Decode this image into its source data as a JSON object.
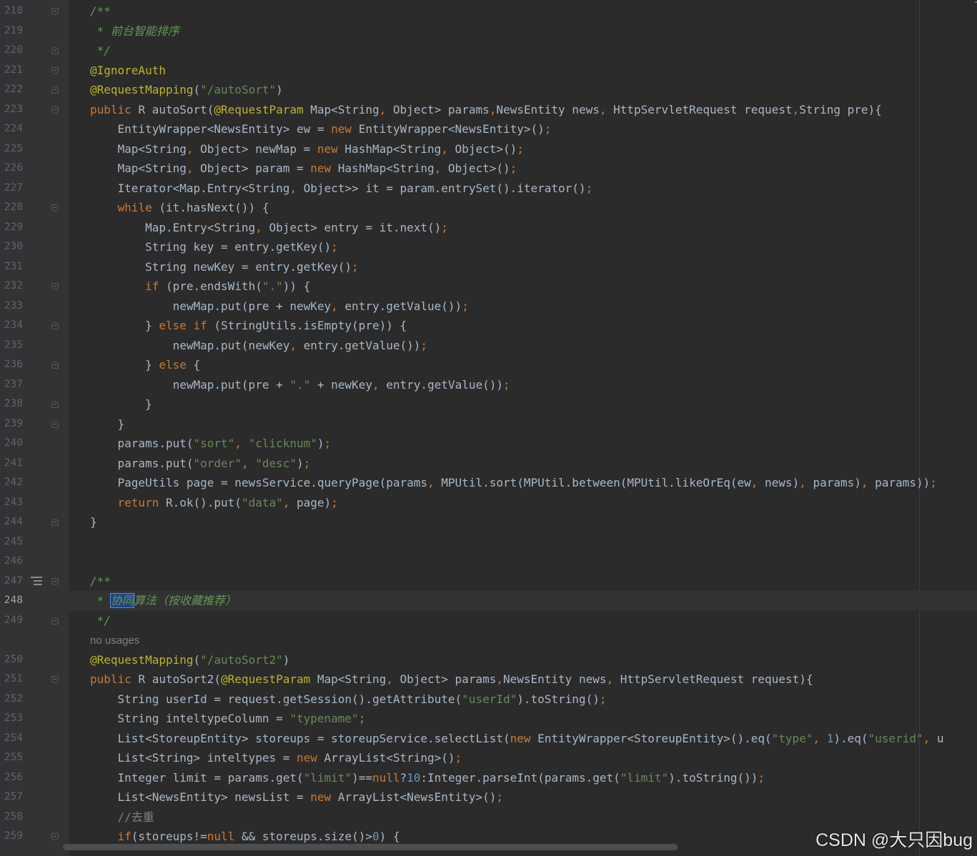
{
  "editor": {
    "lines": [
      {
        "n": "218",
        "fold": "start",
        "segs": [
          [
            "cmt",
            "/**"
          ]
        ]
      },
      {
        "n": "219",
        "segs": [
          [
            "cmt",
            " * 前台智能排序"
          ]
        ]
      },
      {
        "n": "220",
        "fold": "end",
        "segs": [
          [
            "cmt",
            " */"
          ]
        ]
      },
      {
        "n": "221",
        "fold": "start",
        "segs": [
          [
            "ann",
            "@IgnoreAuth"
          ]
        ]
      },
      {
        "n": "222",
        "fold": "end",
        "segs": [
          [
            "ann",
            "@RequestMapping"
          ],
          [
            "",
            "("
          ],
          [
            "str",
            "\"/autoSort\""
          ],
          [
            "",
            ")"
          ]
        ]
      },
      {
        "n": "223",
        "fold": "start",
        "segs": [
          [
            "kw",
            "public "
          ],
          [
            "",
            "R autoSort("
          ],
          [
            "ann",
            "@RequestParam "
          ],
          [
            "",
            "Map<String"
          ],
          [
            "kw",
            ", "
          ],
          [
            "",
            "Object> params"
          ],
          [
            "kw",
            ","
          ],
          [
            "",
            "NewsEntity news"
          ],
          [
            "kw",
            ", "
          ],
          [
            "",
            "HttpServletRequest request"
          ],
          [
            "kw",
            ","
          ],
          [
            "",
            "String pre){"
          ]
        ]
      },
      {
        "n": "224",
        "segs": [
          [
            "",
            "    EntityWrapper<NewsEntity> ew = "
          ],
          [
            "kw",
            "new "
          ],
          [
            "",
            "EntityWrapper<NewsEntity>()"
          ],
          [
            "kw",
            ";"
          ]
        ]
      },
      {
        "n": "225",
        "segs": [
          [
            "",
            "    Map<String"
          ],
          [
            "kw",
            ", "
          ],
          [
            "",
            "Object> newMap = "
          ],
          [
            "kw",
            "new "
          ],
          [
            "",
            "HashMap<String"
          ],
          [
            "kw",
            ", "
          ],
          [
            "",
            "Object>()"
          ],
          [
            "kw",
            ";"
          ]
        ]
      },
      {
        "n": "226",
        "segs": [
          [
            "",
            "    Map<String"
          ],
          [
            "kw",
            ", "
          ],
          [
            "",
            "Object> param = "
          ],
          [
            "kw",
            "new "
          ],
          [
            "",
            "HashMap<String"
          ],
          [
            "kw",
            ", "
          ],
          [
            "",
            "Object>()"
          ],
          [
            "kw",
            ";"
          ]
        ]
      },
      {
        "n": "227",
        "segs": [
          [
            "",
            "    Iterator<Map.Entry<String"
          ],
          [
            "kw",
            ", "
          ],
          [
            "",
            "Object>> it = param.entrySet().iterator()"
          ],
          [
            "kw",
            ";"
          ]
        ]
      },
      {
        "n": "228",
        "fold": "start",
        "segs": [
          [
            "",
            "    "
          ],
          [
            "kw",
            "while "
          ],
          [
            "",
            "(it.hasNext()) {"
          ]
        ]
      },
      {
        "n": "229",
        "segs": [
          [
            "",
            "        Map.Entry<String"
          ],
          [
            "kw",
            ", "
          ],
          [
            "",
            "Object> entry = it.next()"
          ],
          [
            "kw",
            ";"
          ]
        ]
      },
      {
        "n": "230",
        "segs": [
          [
            "",
            "        String key = entry.getKey()"
          ],
          [
            "kw",
            ";"
          ]
        ]
      },
      {
        "n": "231",
        "segs": [
          [
            "",
            "        String newKey = entry.getKey()"
          ],
          [
            "kw",
            ";"
          ]
        ]
      },
      {
        "n": "232",
        "fold": "start",
        "segs": [
          [
            "",
            "        "
          ],
          [
            "kw",
            "if "
          ],
          [
            "",
            "(pre.endsWith("
          ],
          [
            "str",
            "\".\""
          ],
          [
            "",
            ")) {"
          ]
        ]
      },
      {
        "n": "233",
        "segs": [
          [
            "",
            "            newMap.put(pre + newKey"
          ],
          [
            "kw",
            ", "
          ],
          [
            "",
            "entry.getValue())"
          ],
          [
            "kw",
            ";"
          ]
        ]
      },
      {
        "n": "234",
        "fold": "end",
        "segs": [
          [
            "",
            "        } "
          ],
          [
            "kw",
            "else if "
          ],
          [
            "",
            "(StringUtils.isEmpty(pre)) {"
          ]
        ]
      },
      {
        "n": "235",
        "segs": [
          [
            "",
            "            newMap.put(newKey"
          ],
          [
            "kw",
            ", "
          ],
          [
            "",
            "entry.getValue())"
          ],
          [
            "kw",
            ";"
          ]
        ]
      },
      {
        "n": "236",
        "fold": "end",
        "segs": [
          [
            "",
            "        } "
          ],
          [
            "kw",
            "else "
          ],
          [
            "",
            "{"
          ]
        ]
      },
      {
        "n": "237",
        "segs": [
          [
            "",
            "            newMap.put(pre + "
          ],
          [
            "str",
            "\".\""
          ],
          [
            "",
            " + newKey"
          ],
          [
            "kw",
            ", "
          ],
          [
            "",
            "entry.getValue())"
          ],
          [
            "kw",
            ";"
          ]
        ]
      },
      {
        "n": "238",
        "fold": "end",
        "segs": [
          [
            "",
            "        }"
          ]
        ]
      },
      {
        "n": "239",
        "fold": "end",
        "segs": [
          [
            "",
            "    }"
          ]
        ]
      },
      {
        "n": "240",
        "segs": [
          [
            "",
            "    params.put("
          ],
          [
            "str",
            "\"sort\""
          ],
          [
            "kw",
            ", "
          ],
          [
            "str",
            "\"clicknum\""
          ],
          [
            "",
            ")"
          ],
          [
            "kw",
            ";"
          ]
        ]
      },
      {
        "n": "241",
        "segs": [
          [
            "",
            "    params.put("
          ],
          [
            "str",
            "\"order\""
          ],
          [
            "kw",
            ", "
          ],
          [
            "str",
            "\"desc\""
          ],
          [
            "",
            ")"
          ],
          [
            "kw",
            ";"
          ]
        ]
      },
      {
        "n": "242",
        "segs": [
          [
            "",
            "    PageUtils page = newsService.queryPage(params"
          ],
          [
            "kw",
            ", "
          ],
          [
            "",
            "MPUtil.sort(MPUtil.between(MPUtil.likeOrEq(ew"
          ],
          [
            "kw",
            ", "
          ],
          [
            "",
            "news)"
          ],
          [
            "kw",
            ", "
          ],
          [
            "",
            "params)"
          ],
          [
            "kw",
            ", "
          ],
          [
            "",
            "params))"
          ],
          [
            "kw",
            ";"
          ]
        ]
      },
      {
        "n": "243",
        "segs": [
          [
            "",
            "    "
          ],
          [
            "kw",
            "return "
          ],
          [
            "",
            "R.ok().put("
          ],
          [
            "str",
            "\"data\""
          ],
          [
            "kw",
            ", "
          ],
          [
            "",
            "page)"
          ],
          [
            "kw",
            ";"
          ]
        ]
      },
      {
        "n": "244",
        "fold": "end",
        "segs": [
          [
            "",
            "}"
          ]
        ]
      },
      {
        "n": "245",
        "segs": []
      },
      {
        "n": "246",
        "segs": []
      },
      {
        "n": "247",
        "fold": "start",
        "docicon": true,
        "segs": [
          [
            "cmt",
            "/**"
          ]
        ]
      },
      {
        "n": "248",
        "current": true,
        "segs": [
          [
            "cmt",
            " * "
          ],
          [
            "cmt sel",
            "协同"
          ],
          [
            "cmt",
            "算法（按收藏推荐）"
          ]
        ]
      },
      {
        "n": "249",
        "fold": "end",
        "segs": [
          [
            "cmt",
            " */"
          ]
        ]
      },
      {
        "n": "",
        "hint": true,
        "segs": [
          [
            "hint",
            "no usages"
          ]
        ]
      },
      {
        "n": "250",
        "segs": [
          [
            "ann",
            "@RequestMapping"
          ],
          [
            "",
            "("
          ],
          [
            "str",
            "\"/autoSort2\""
          ],
          [
            "",
            ")"
          ]
        ]
      },
      {
        "n": "251",
        "fold": "start",
        "segs": [
          [
            "kw",
            "public "
          ],
          [
            "",
            "R autoSort2("
          ],
          [
            "ann",
            "@RequestParam "
          ],
          [
            "",
            "Map<String"
          ],
          [
            "kw",
            ", "
          ],
          [
            "",
            "Object> params"
          ],
          [
            "kw",
            ","
          ],
          [
            "",
            "NewsEntity news"
          ],
          [
            "kw",
            ", "
          ],
          [
            "",
            "HttpServletRequest request){"
          ]
        ]
      },
      {
        "n": "252",
        "segs": [
          [
            "",
            "    String userId = request.getSession().getAttribute("
          ],
          [
            "str",
            "\"userId\""
          ],
          [
            "",
            ").toString()"
          ],
          [
            "kw",
            ";"
          ]
        ]
      },
      {
        "n": "253",
        "segs": [
          [
            "",
            "    String inteltypeColumn = "
          ],
          [
            "str",
            "\"typename\""
          ],
          [
            "kw",
            ";"
          ]
        ]
      },
      {
        "n": "254",
        "segs": [
          [
            "",
            "    List<StoreupEntity> storeups = storeupService.selectList("
          ],
          [
            "kw",
            "new "
          ],
          [
            "",
            "EntityWrapper<StoreupEntity>().eq("
          ],
          [
            "str",
            "\"type\""
          ],
          [
            "kw",
            ", "
          ],
          [
            "num",
            "1"
          ],
          [
            "",
            ").eq("
          ],
          [
            "str",
            "\"userid\""
          ],
          [
            "kw",
            ", "
          ],
          [
            "",
            "u"
          ]
        ]
      },
      {
        "n": "255",
        "segs": [
          [
            "",
            "    List<String> inteltypes = "
          ],
          [
            "kw",
            "new "
          ],
          [
            "",
            "ArrayList<String>()"
          ],
          [
            "kw",
            ";"
          ]
        ]
      },
      {
        "n": "256",
        "segs": [
          [
            "",
            "    Integer limit = params.get("
          ],
          [
            "str",
            "\"limit\""
          ],
          [
            "",
            ")=="
          ],
          [
            "kw",
            "null"
          ],
          [
            "",
            "?"
          ],
          [
            "num",
            "10"
          ],
          [
            "",
            ":Integer.parseInt(params.get("
          ],
          [
            "str",
            "\"limit\""
          ],
          [
            "",
            ").toString())"
          ],
          [
            "kw",
            ";"
          ]
        ]
      },
      {
        "n": "257",
        "segs": [
          [
            "",
            "    List<NewsEntity> newsList = "
          ],
          [
            "kw",
            "new "
          ],
          [
            "",
            "ArrayList<NewsEntity>()"
          ],
          [
            "kw",
            ";"
          ]
        ]
      },
      {
        "n": "258",
        "segs": [
          [
            "",
            "    "
          ],
          [
            "lc",
            "//去重"
          ]
        ]
      },
      {
        "n": "259",
        "fold": "start",
        "segs": [
          [
            "",
            "    "
          ],
          [
            "kw",
            "if"
          ],
          [
            "",
            "(storeups!="
          ],
          [
            "kw",
            "null "
          ],
          [
            "",
            "&& storeups.size()>"
          ],
          [
            "num",
            "0"
          ],
          [
            "",
            ") {"
          ]
        ]
      }
    ]
  },
  "watermark": "CSDN @大只因bug",
  "colors": {
    "background": "#2b2b2b",
    "keyword": "#cc7832",
    "string": "#6a8759",
    "annotation": "#bbb529",
    "doc_comment": "#629755",
    "number": "#6897bb"
  }
}
